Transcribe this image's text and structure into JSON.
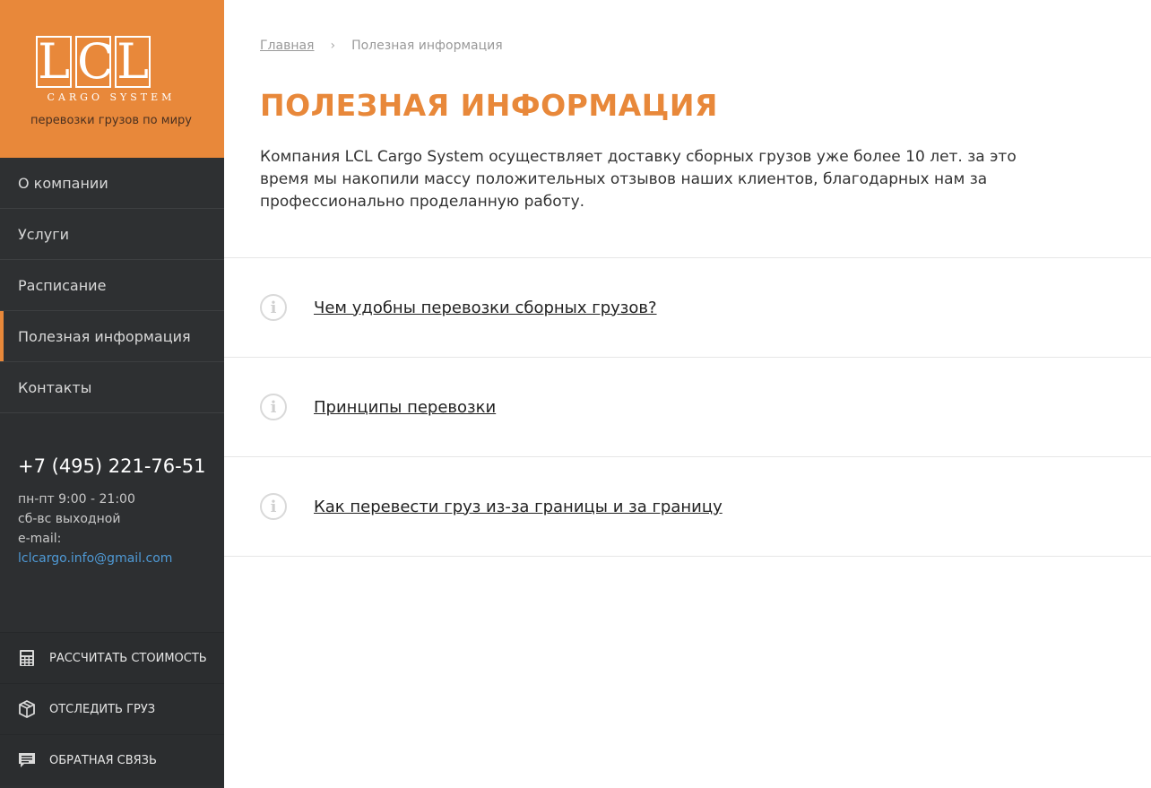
{
  "logo": {
    "letters": [
      "L",
      "C",
      "L"
    ],
    "subtitle": "CARGO SYSTEM",
    "tagline": "перевозки грузов по миру"
  },
  "nav": {
    "items": [
      {
        "label": "О компании",
        "active": false
      },
      {
        "label": "Услуги",
        "active": false
      },
      {
        "label": "Расписание",
        "active": false
      },
      {
        "label": "Полезная информация",
        "active": true
      },
      {
        "label": "Контакты",
        "active": false
      }
    ]
  },
  "contact": {
    "phone": "+7 (495) 221-76-51",
    "hours_weekdays": "пн-пт 9:00 - 21:00",
    "hours_weekend": "сб-вс выходной",
    "email_label": "e-mail:",
    "email": "lclcargo.info@gmail.com"
  },
  "actions": {
    "calculate": {
      "label": "РАССЧИТАТЬ СТОИМОСТЬ",
      "icon": "calculator-icon"
    },
    "track": {
      "label": "ОТСЛЕДИТЬ ГРУЗ",
      "icon": "package-icon"
    },
    "feedback": {
      "label": "ОБРАТНАЯ СВЯЗЬ",
      "icon": "chat-icon"
    }
  },
  "breadcrumb": {
    "home": "Главная",
    "separator": "›",
    "current": "Полезная информация"
  },
  "page": {
    "title": "ПОЛЕЗНАЯ ИНФОРМАЦИЯ",
    "intro": "Компания LCL Cargo System осуществляет доставку сборных грузов уже более 10 лет. за это время мы накопили массу положительных отзывов наших клиентов, благодарных нам за профессионально проделанную работу."
  },
  "faq": {
    "icon_glyph": "i",
    "items": [
      {
        "label": "Чем удобны перевозки сборных грузов?"
      },
      {
        "label": "Принципы перевозки"
      },
      {
        "label": "Как перевести груз из-за границы и за границу"
      }
    ]
  },
  "colors": {
    "accent": "#e8883a",
    "sidebar": "#2d2f31",
    "link": "#4f9ad6"
  }
}
